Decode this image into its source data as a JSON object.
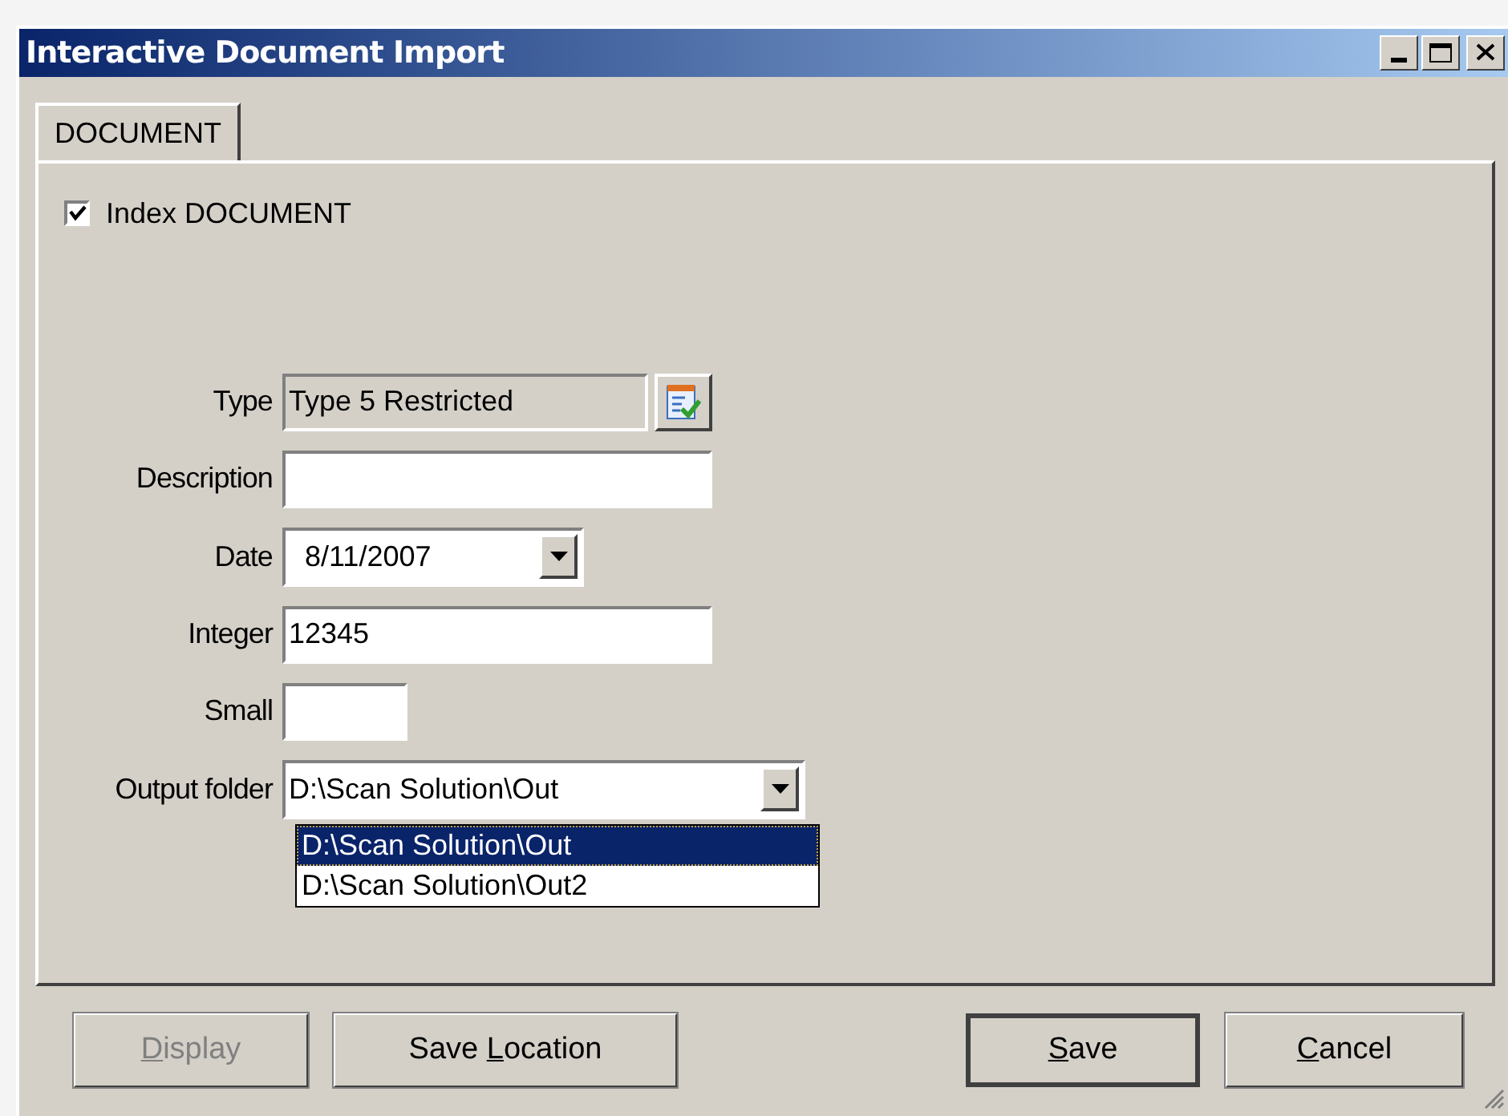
{
  "window": {
    "title": "Interactive Document Import"
  },
  "tabs": [
    {
      "label": "DOCUMENT",
      "selected": true
    }
  ],
  "index_checkbox": {
    "label": "Index DOCUMENT",
    "checked": true
  },
  "fields": [
    {
      "kind": "lookup",
      "label": "Type",
      "value": "Type 5 Restricted"
    },
    {
      "kind": "text",
      "label": "Description"
    },
    {
      "kind": "date",
      "label": "Date",
      "value": "8/11/2007"
    },
    {
      "kind": "text",
      "label": "Integer",
      "value": "12345"
    },
    {
      "kind": "small",
      "label": "Small"
    },
    {
      "kind": "combo",
      "label": "Output folder",
      "value": "D:\\Scan Solution\\Out",
      "expanded": true,
      "options": [
        {
          "label": "D:\\Scan Solution\\Out",
          "selected": true
        },
        {
          "label": "D:\\Scan Solution\\Out2",
          "selected": false
        }
      ]
    }
  ],
  "buttons": [
    {
      "key": "D",
      "after": "isplay",
      "disabled": true,
      "default": false
    },
    {
      "before": "Save ",
      "key": "L",
      "after": "ocation",
      "disabled": false,
      "default": false
    },
    {
      "key": "S",
      "after": "ave",
      "disabled": false,
      "default": true
    },
    {
      "key": "C",
      "after": "ancel",
      "disabled": false,
      "default": false
    }
  ]
}
